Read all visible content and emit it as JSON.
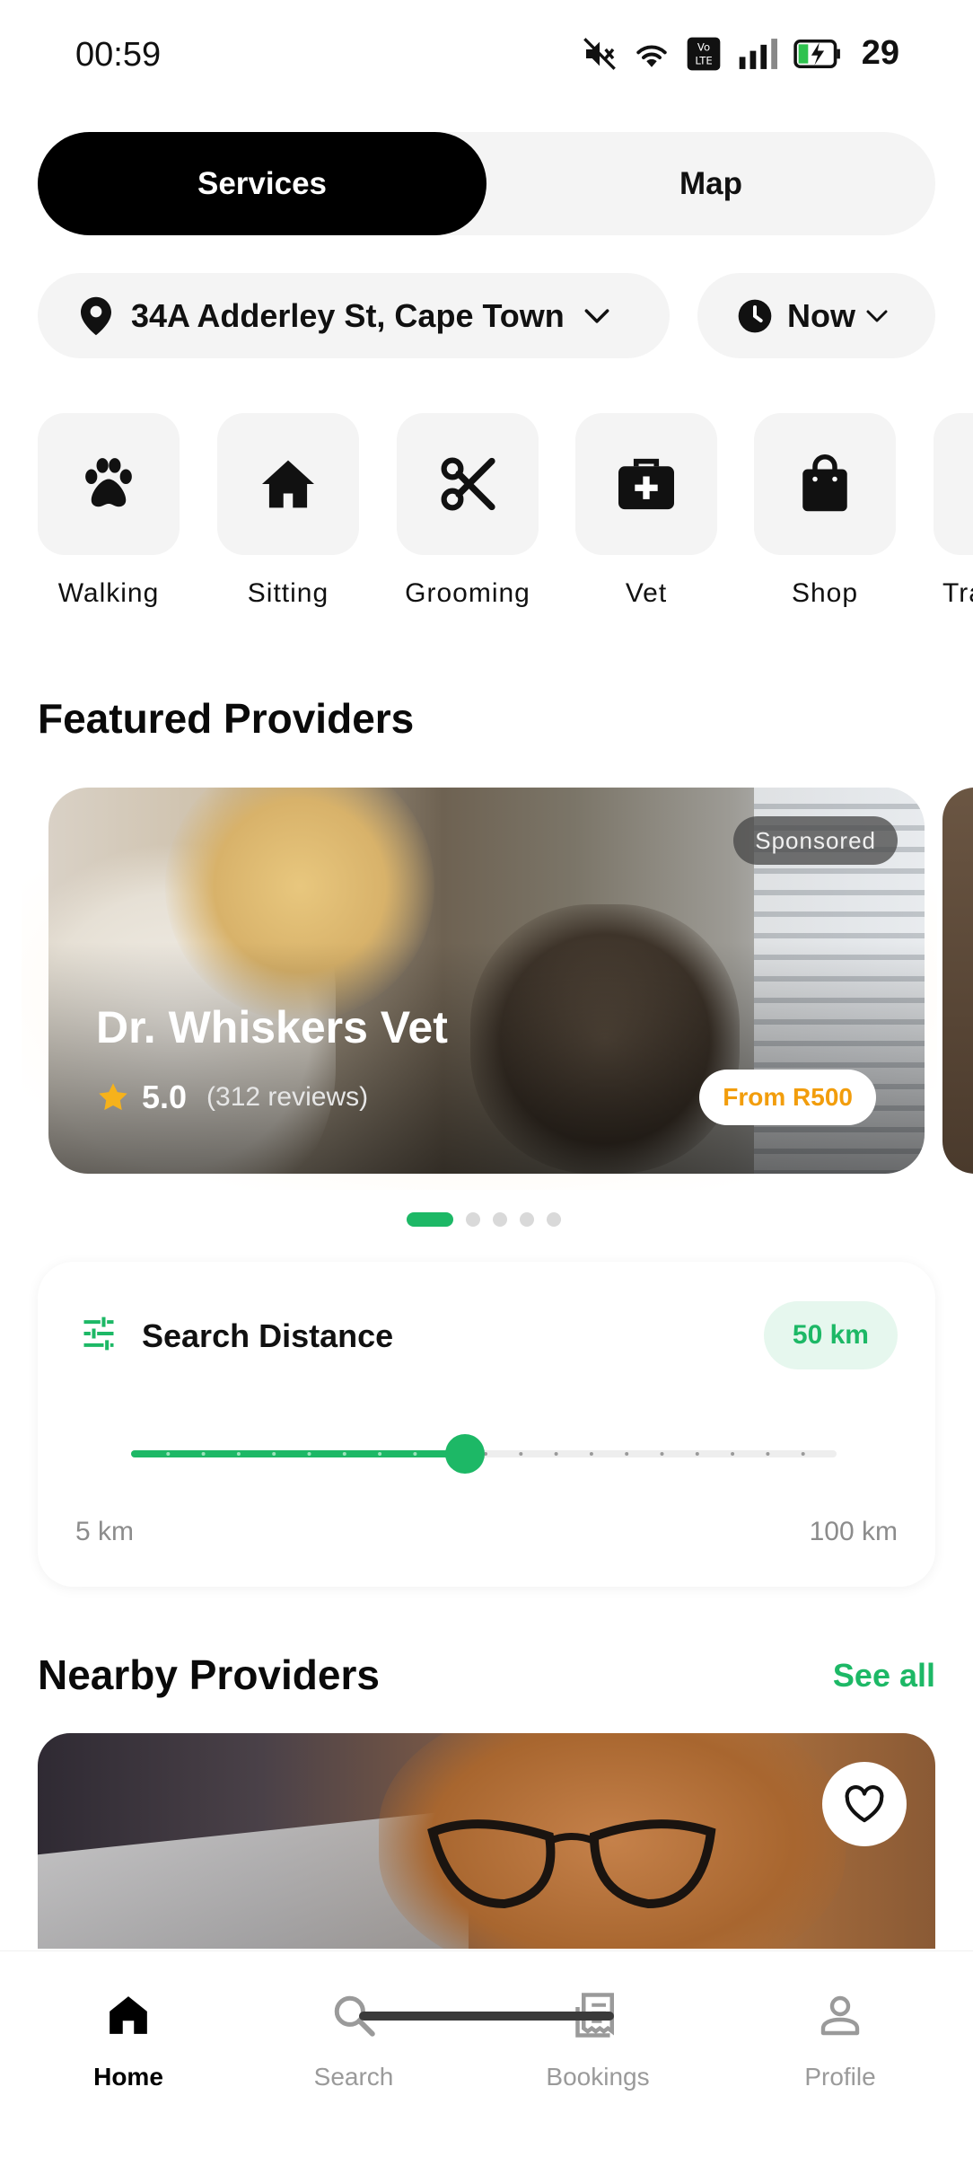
{
  "status_bar": {
    "time": "00:59",
    "battery_level": "29",
    "icons": [
      "mute-icon",
      "wifi-icon",
      "volte-icon",
      "signal-icon",
      "battery-charging-icon"
    ]
  },
  "segmented": {
    "options": [
      "Services",
      "Map"
    ],
    "selected": "Services"
  },
  "location": {
    "address": "34A Adderley St, Cape Town",
    "time_label": "Now"
  },
  "categories": [
    {
      "label": "Walking",
      "icon": "paw-icon"
    },
    {
      "label": "Sitting",
      "icon": "home-icon"
    },
    {
      "label": "Grooming",
      "icon": "scissors-icon"
    },
    {
      "label": "Vet",
      "icon": "medical-kit-icon"
    },
    {
      "label": "Shop",
      "icon": "shopping-bag-icon"
    },
    {
      "label": "Tra",
      "icon": "training-icon"
    }
  ],
  "featured": {
    "title": "Featured Providers",
    "card": {
      "name": "Dr. Whiskers Vet",
      "rating": "5.0",
      "reviews": "(312 reviews)",
      "price": "From R500",
      "badge": "Sponsored"
    },
    "dots": 5,
    "active_dot": 0
  },
  "search_distance": {
    "title": "Search Distance",
    "value_label": "50 km",
    "value": 50,
    "min": 5,
    "max": 100,
    "min_label": "5 km",
    "max_label": "100 km"
  },
  "nearby": {
    "title": "Nearby Providers",
    "see_all": "See all"
  },
  "bottom_nav": {
    "items": [
      {
        "label": "Home",
        "icon": "home-icon",
        "active": true
      },
      {
        "label": "Search",
        "icon": "search-icon",
        "active": false
      },
      {
        "label": "Bookings",
        "icon": "receipt-icon",
        "active": false
      },
      {
        "label": "Profile",
        "icon": "person-icon",
        "active": false
      }
    ]
  },
  "colors": {
    "accent": "#1db866",
    "price": "#f29d0c",
    "chip_bg": "#f4f4f4"
  }
}
